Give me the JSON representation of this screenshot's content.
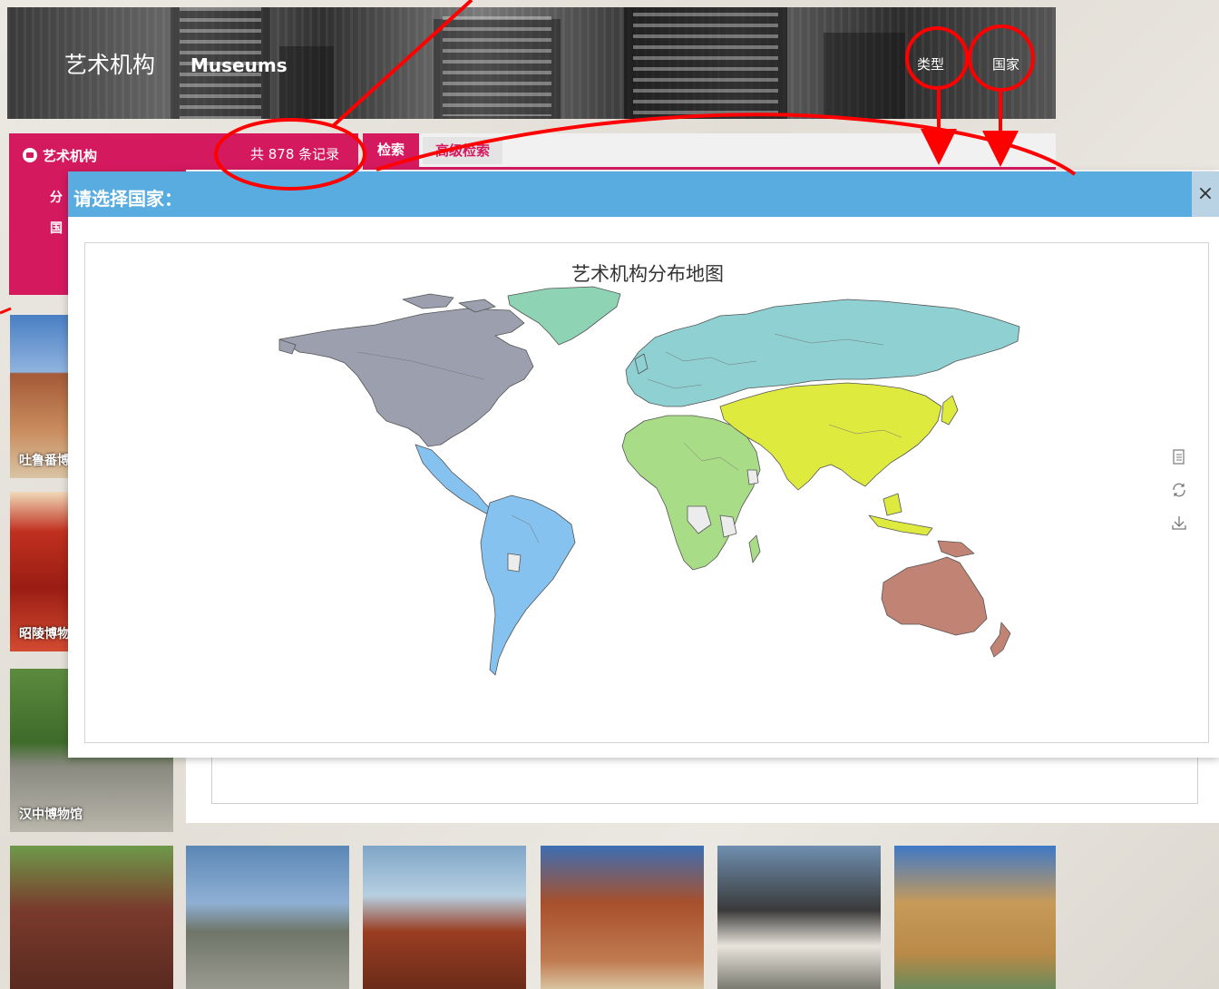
{
  "header": {
    "title": "艺术机构",
    "subtitle": "Museums",
    "nav": {
      "type": "类型",
      "country": "国家"
    }
  },
  "side_panel": {
    "title": "艺术机构",
    "record_count": "共 878 条记录",
    "cut_label_1": "分",
    "cut_label_2": "国"
  },
  "tabs": {
    "search": "检索",
    "advanced": "高级检索"
  },
  "modal": {
    "title": "请选择国家：",
    "close": "×",
    "map_title": "艺术机构分布地图",
    "tools": [
      "data-view-icon",
      "restore-icon",
      "save-image-icon"
    ]
  },
  "thumbnails": [
    {
      "caption": "吐鲁番博",
      "color": "#a35a38"
    },
    {
      "caption": "昭陵博物",
      "color": "#c0301f"
    },
    {
      "caption": "汉中博物馆",
      "color": "#4e7a3a"
    },
    {
      "caption": "",
      "color": "#7a3a2c"
    },
    {
      "caption": "",
      "color": "#5b87b5"
    },
    {
      "caption": "",
      "color": "#7fa6c8"
    },
    {
      "caption": "",
      "color": "#a8502c"
    },
    {
      "caption": "",
      "color": "#6f8fb0"
    },
    {
      "caption": "",
      "color": "#3f79c6"
    }
  ],
  "colors": {
    "brand": "#d4195f",
    "modal_header": "#58ace0",
    "annotation": "#ff0000",
    "region_north_america": "#9b9fae",
    "region_greenland": "#8fd3b5",
    "region_south_america": "#85c2f0",
    "region_central_america": "#85c2f0",
    "region_europe_russia": "#8fd0d3",
    "region_africa": "#a9dc86",
    "region_asia": "#dfea3f",
    "region_oceania": "#c18374",
    "region_nodata": "#ececec"
  }
}
